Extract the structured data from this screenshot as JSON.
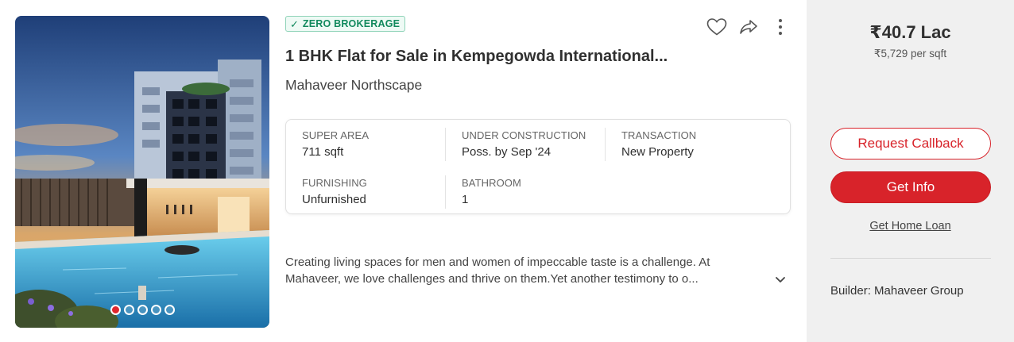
{
  "listing": {
    "badge": "ZERO BROKERAGE",
    "title": "1 BHK Flat for Sale in Kempegowda International...",
    "project": "Mahaveer Northscape",
    "summary": [
      {
        "label": "SUPER AREA",
        "value": "711 sqft"
      },
      {
        "label": "UNDER CONSTRUCTION",
        "value": "Poss. by Sep '24"
      },
      {
        "label": "TRANSACTION",
        "value": "New Property"
      },
      {
        "label": "FURNISHING",
        "value": "Unfurnished"
      },
      {
        "label": "BATHROOM",
        "value": "1"
      }
    ],
    "description_line1": "Creating living spaces for men and women of impeccable taste is a challenge. At",
    "description_line2": "Mahaveer, we love challenges and thrive on them.Yet another testimony to o...",
    "gallery": {
      "count": 5,
      "active_index": 0
    }
  },
  "icons": {
    "badge": "check-icon",
    "actions": [
      "heart-icon",
      "share-icon",
      "kebab-menu-icon"
    ],
    "expand": "chevron-down-icon"
  },
  "pricing": {
    "price": "₹40.7 Lac",
    "per_sqft": "₹5,729 per sqft"
  },
  "cta": {
    "callback_label": "Request Callback",
    "info_label": "Get Info",
    "loan_label": "Get Home Loan"
  },
  "builder": "Builder: Mahaveer Group",
  "colors": {
    "accent": "#d8232a",
    "badge_green": "#11895d",
    "side_bg": "#f0f0f0"
  }
}
